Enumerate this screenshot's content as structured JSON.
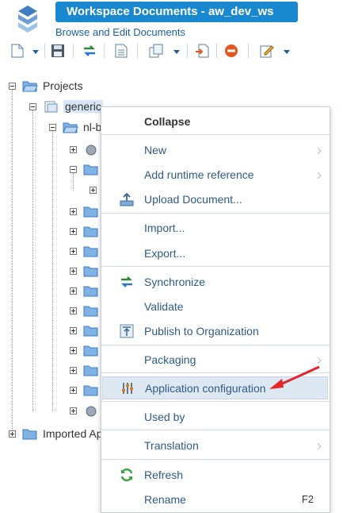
{
  "header": {
    "title": "Workspace Documents - aw_dev_ws",
    "subtitle": "Browse and Edit Documents"
  },
  "toolbar": {
    "buttons": [
      "new-document-icon",
      "save-icon",
      "synchronize-icon",
      "document-icon",
      "copy-icon",
      "import-icon",
      "remove-icon",
      "edit-icon"
    ]
  },
  "tree": {
    "projects_label": "Projects",
    "generic_label": "generic",
    "nl_label": "nl-b",
    "imported_label": "Imported Ap"
  },
  "context_menu": {
    "collapse": "Collapse",
    "new": "New",
    "add_runtime_reference": "Add runtime reference",
    "upload_document": "Upload Document...",
    "import": "Import...",
    "export": "Export...",
    "synchronize": "Synchronize",
    "validate": "Validate",
    "publish": "Publish to Organization",
    "packaging": "Packaging",
    "app_config": "Application configuration",
    "used_by": "Used by",
    "translation": "Translation",
    "refresh": "Refresh",
    "rename": "Rename",
    "rename_shortcut": "F2"
  },
  "colors": {
    "title_bar": "#1a88cf",
    "menu_text": "#2d5b86",
    "highlight": "#dde8f3",
    "arrow": "#e3262b"
  }
}
